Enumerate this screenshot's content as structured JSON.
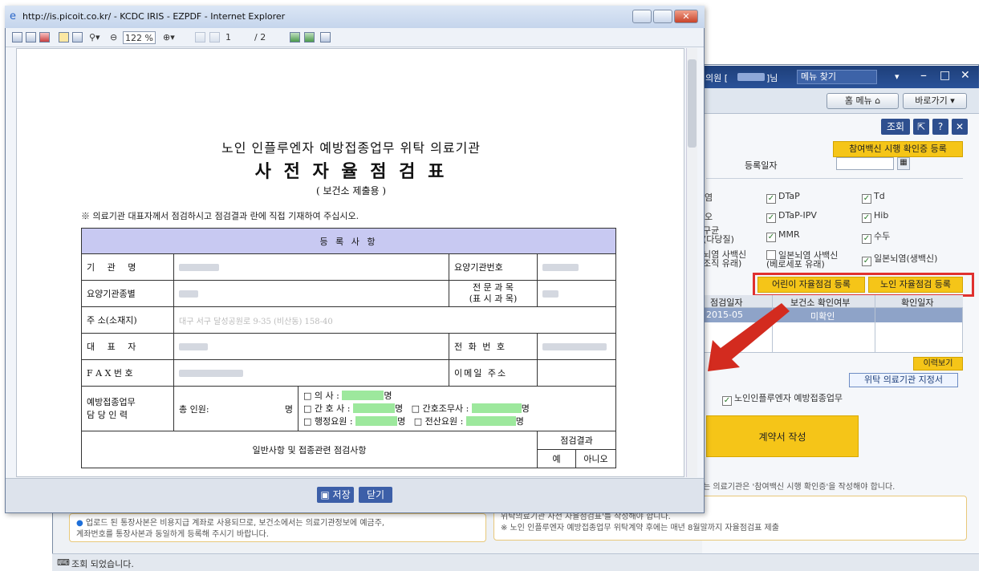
{
  "app": {
    "titlebar": {
      "user_prefix": "의원 [",
      "user_suffix": "]님",
      "menu_search": "메뉴 찾기"
    },
    "toolbar": {
      "home": "홈 메뉴",
      "shortcut": "바로가기"
    },
    "query_button": "조회",
    "participation_cert_button": "참여백신 시행 확인증 등록",
    "reg_date_label": "등록일자",
    "vaccines": [
      "DTaP",
      "Td",
      "DTaP-IPV",
      "Hib",
      "MMR",
      "수두",
      "일본뇌염 사백신\n(베로세포 유래)",
      "일본뇌염(생백신)"
    ],
    "partial_labels": [
      "염",
      "오",
      "구균\n(다당질)",
      "뇌염 사백신\n조직 유래)"
    ],
    "child_selfcheck_button": "어린이 자율점검 등록",
    "elder_selfcheck_button": "노인 자율점검 등록",
    "grid": {
      "headers": [
        "점검일자",
        "보건소 확인여부",
        "확인일자"
      ],
      "row": [
        "2015-05",
        "미확인",
        ""
      ]
    },
    "history_button": "이력보기",
    "designation_button": "위탁 의료기관 지정서",
    "influenza_check": "노인인플루엔자 예방접종업무",
    "contract_button": "계약서 작성",
    "info_left": "업로드 된 통장사본은 비용지급 계좌로 사용되므로, 보건소에서는 의료기관정보에 예금주,\n계좌번호를 통장사본과 동일하게 등록해 주시기 바랍니다.",
    "info_right_1": "는 의료기관은 '참여백신 시행 확인증'을 작성해야 합니다.",
    "info_right_2": "을 희망하는 의료기관은 '노인 인플루엔자 예방접종업무\n위탁의료기관 사전 자율점검표'를 작성해야 합니다.",
    "info_right_3": "※ 노인 인플루엔자 예방접종업무 위탁계약 후에는 매년 8월말까지 자율점검표 제출",
    "status": "조회 되었습니다."
  },
  "pdf_window": {
    "title": "http://is.picoit.co.kr/ - KCDC IRIS - EZPDF - Internet Explorer",
    "zoom": "122 %",
    "page_current": "1",
    "page_total": "/ 2",
    "save_button": "저장",
    "close_button": "닫기"
  },
  "document": {
    "heading": "노인 인플루엔자 예방접종업무 위탁 의료기관",
    "title": "사 전 자 율 점 검 표",
    "subtitle": "( 보건소 제출용 )",
    "note": "※ 의료기관 대표자께서 점검하시고 점검결과 란에 직접 기재하여 주십시오.",
    "section_title": "등 록 사 항",
    "rows": {
      "institution": "기 관 명",
      "code": "요양기관번호",
      "type": "요양기관종별",
      "specialty": "전 문 과 목\n(표 시 과 목)",
      "address": "주 소(소재지)",
      "address_value": "대구 서구 달성공원로 9-35 (비산동) 158-40",
      "rep": "대 표 자",
      "tel": "전 화 번 호",
      "fax": "F A X 번 호",
      "email": "이메일 주소",
      "staff": "예방접종업무\n담 당 인 력",
      "total": "총 인원:",
      "unit": "명",
      "doctor": "□ 의    사 :",
      "nurse": "□ 간 호 사 :",
      "admin": "□ 행정요원 :",
      "nurse_aide": "□ 간호조무사 :",
      "it": "□ 전산요원 :"
    },
    "section2": "일반사항 및 접종관련 점검사항",
    "result": "점검결과",
    "yes": "예",
    "no": "아니오"
  }
}
